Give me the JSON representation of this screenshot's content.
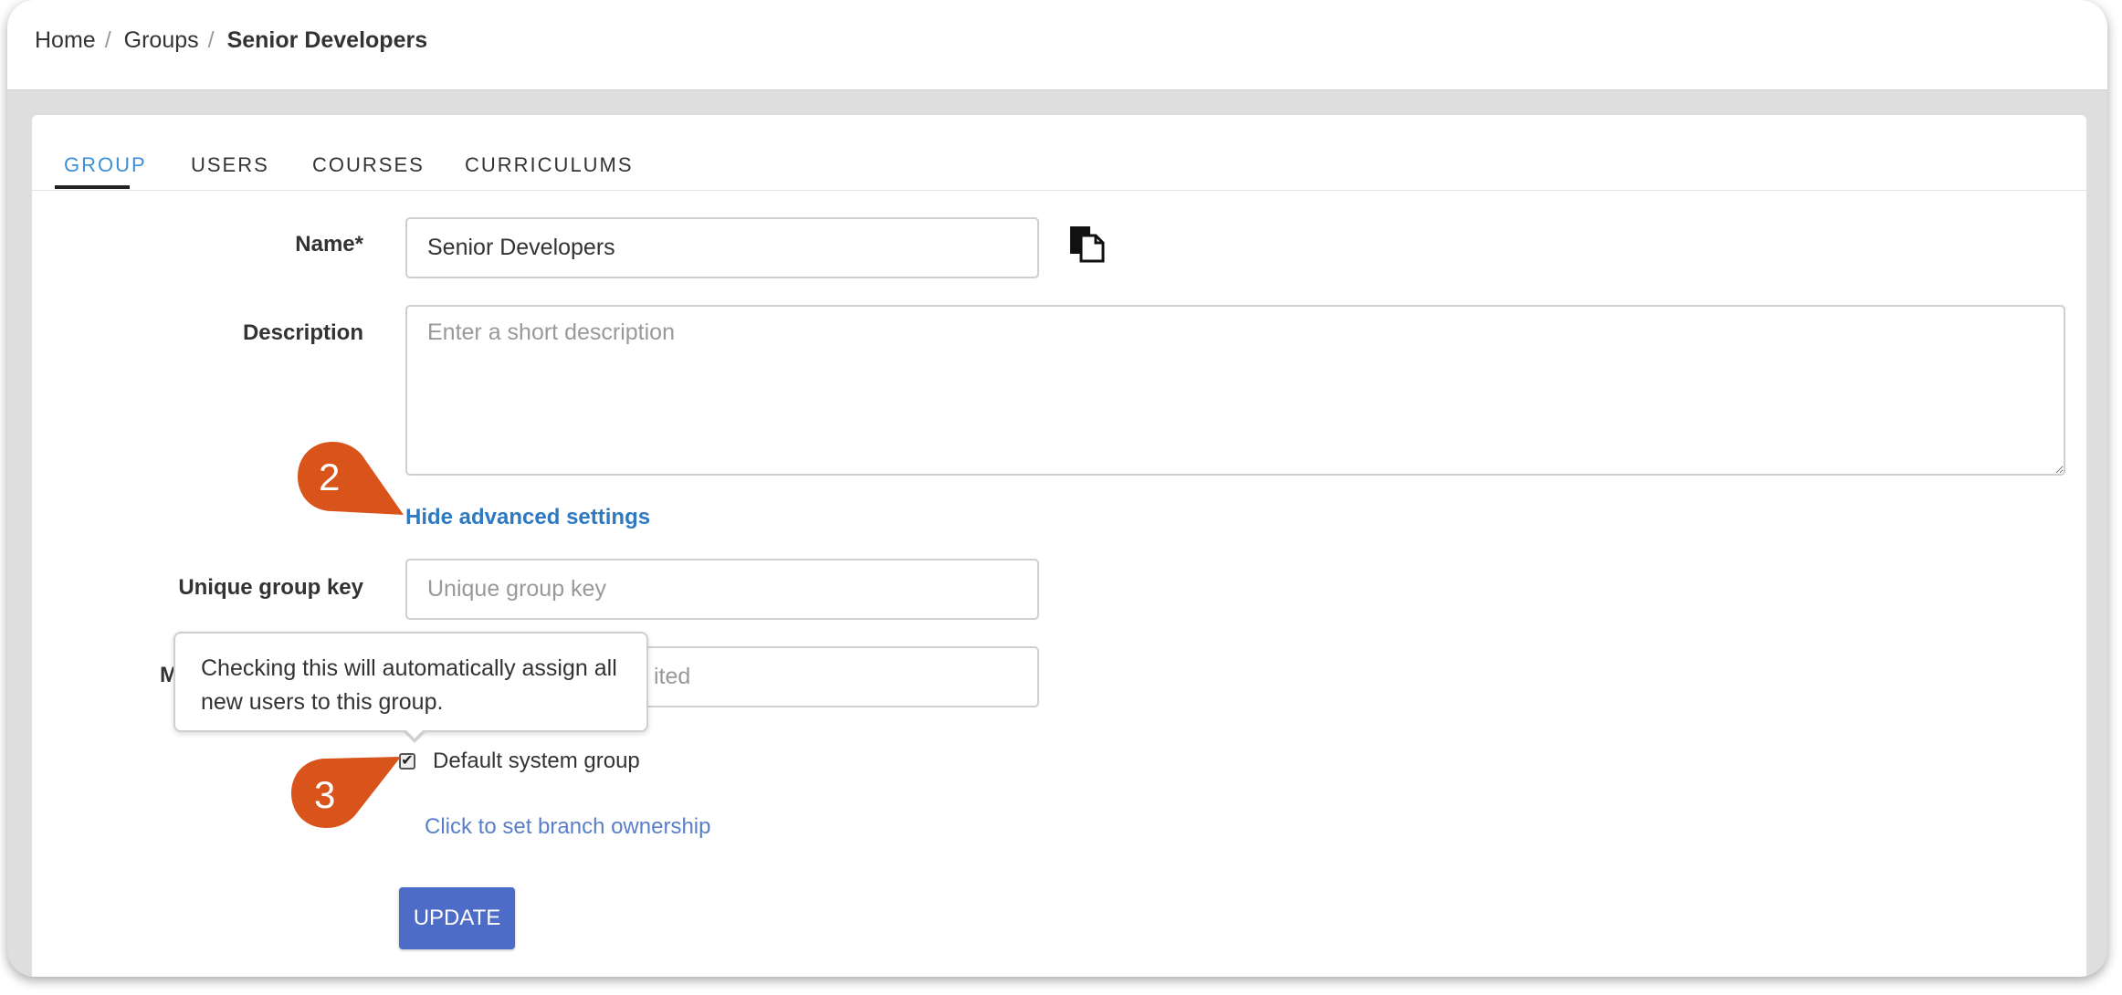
{
  "breadcrumb": {
    "items": [
      "Home",
      "Groups"
    ],
    "current": "Senior Developers"
  },
  "tabs": [
    {
      "label": "GROUP",
      "active": true
    },
    {
      "label": "USERS",
      "active": false
    },
    {
      "label": "COURSES",
      "active": false
    },
    {
      "label": "CURRICULUMS",
      "active": false
    }
  ],
  "form": {
    "name_label": "Name*",
    "name_value": "Senior Developers",
    "description_label": "Description",
    "description_placeholder": "Enter a short description",
    "advanced_link": "Hide advanced settings",
    "unique_key_label": "Unique group key",
    "unique_key_placeholder": "Unique group key",
    "max_label_visible": "M",
    "max_placeholder_visible": "ited",
    "default_group_label": "Default system group",
    "default_group_checked": true,
    "branch_link": "Click to set branch ownership",
    "update_button": "UPDATE"
  },
  "tooltip": {
    "text": "Checking this will automatically assign all new users to this group."
  },
  "annotations": [
    {
      "number": "2"
    },
    {
      "number": "3"
    }
  ],
  "icons": {
    "copy": "copy-icon"
  },
  "colors": {
    "accent_tab": "#3b8fd6",
    "link": "#2d7ac2",
    "branch_link": "#5a7fc9",
    "button": "#4d6cc8",
    "marker": "#d9541a"
  }
}
